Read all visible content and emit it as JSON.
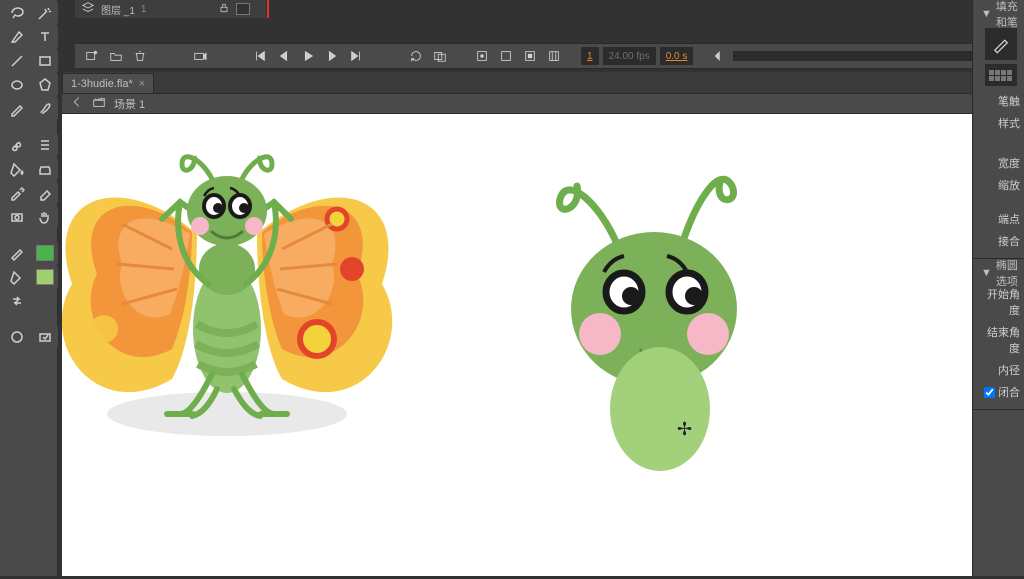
{
  "timeline": {
    "layer_icon": "layers-icon",
    "layer_label": "图层 _1",
    "layer_badge": "1",
    "playhead_pos": 0.1
  },
  "controls": {
    "frame_field": "1",
    "fps": "24.00 fps",
    "elapsed": "0.0 s"
  },
  "tab": {
    "filename": "1-3hudie.fla*",
    "close": "×"
  },
  "breadcrumb": {
    "label": "场景 1"
  },
  "right": {
    "sec_fill_stroke": "填充和笔",
    "row_stroke": "笔触",
    "row_style": "样式",
    "row_width": "宽度",
    "row_scale": "缩放",
    "row_cap": "端点",
    "row_join": "接合",
    "sec_oval": "椭圆选项",
    "row_start": "开始角度",
    "row_end": "结束角度",
    "row_inner": "内径",
    "row_closed": "闭合"
  },
  "colors": {
    "fill": "#4bb34b",
    "secondary": "#a1cf6d"
  }
}
